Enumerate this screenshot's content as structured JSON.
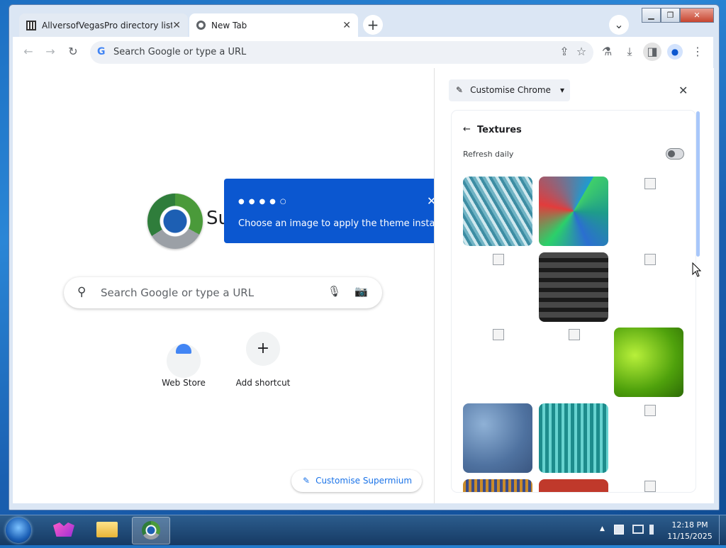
{
  "window": {
    "controls": {
      "minimize": "▁",
      "maximize": "❐",
      "close": "✕"
    }
  },
  "tabs": [
    {
      "title": "AllversofVegasPro directory listin",
      "icon": "archive-icon",
      "close": "✕"
    },
    {
      "title": "New Tab",
      "icon": "chrome-icon",
      "close": "✕"
    }
  ],
  "new_tab_button": "+",
  "tab_search_button": "⌄",
  "toolbar": {
    "back": "←",
    "forward": "→",
    "reload": "↻",
    "omnibox_placeholder": "Search Google or type a URL",
    "google_g": "G",
    "share": "⇪",
    "bookmark": "☆",
    "extension": "⚗",
    "download": "⤓",
    "sidepanel": "◨",
    "profile": "●",
    "menu": "⋮"
  },
  "ntp": {
    "brand_partial": "Su",
    "search_placeholder": "Search Google or type a URL",
    "search_icon": "⚲",
    "mic_icon": "🎙",
    "camera_icon": "📷",
    "shortcuts": [
      {
        "label": "Web Store",
        "icon": "webstore-icon"
      },
      {
        "label": "Add shortcut",
        "icon": "+"
      }
    ],
    "customise_label": "Customise Supermium",
    "customise_icon": "✎"
  },
  "tooltip": {
    "dots": "●●●●○",
    "message": "Choose an image to apply the theme instantly",
    "close": "✕"
  },
  "side_panel": {
    "selector_label": "Customise Chrome",
    "selector_icon": "✎",
    "selector_caret": "▾",
    "close": "✕",
    "section_title": "Textures",
    "back": "←",
    "refresh_label": "Refresh daily",
    "refresh_daily": false,
    "colors": {
      "accent": "#0b57d0",
      "link": "#1a73e8"
    }
  },
  "taskbar": {
    "time": "12:18 PM",
    "date": "11/15/2025",
    "tray_up": "▲"
  }
}
